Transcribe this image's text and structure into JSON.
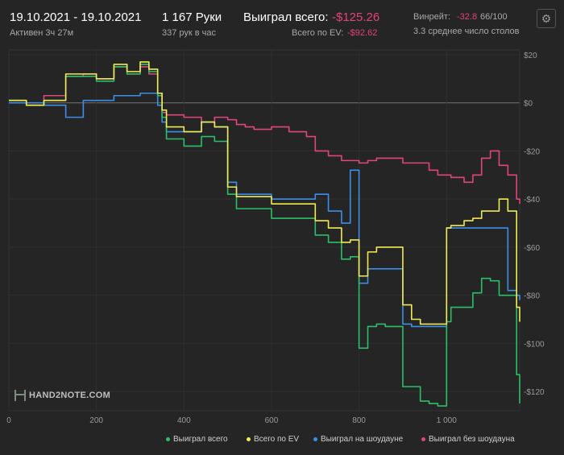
{
  "header": {
    "date_range": "19.10.2021 - 19.10.2021",
    "active_time": "Активен 3ч 27м",
    "hands": "1 167 Руки",
    "hands_per_hour": "337 рук в час",
    "won_total_label": "Выиграл всего:",
    "won_total_value": "-$125.26",
    "ev_label": "Всего по EV:",
    "ev_value": "-$92.62",
    "winrate_label": "Винрейт:",
    "winrate_value": "-32.8",
    "winrate_unit": "66/100",
    "avg_tables": "3.3 среднее число столов"
  },
  "logo": {
    "text": "HAND2NOTE.COM"
  },
  "icons": {
    "settings": "gear-icon"
  },
  "colors": {
    "background": "#252525",
    "negative": "#e0457b",
    "won_total": "#2bbf6a",
    "ev": "#f2ea52",
    "showdown": "#3b8fe8",
    "non_showdown": "#e0457b"
  },
  "chart_data": {
    "type": "line",
    "xlim": [
      0,
      1167
    ],
    "ylim": [
      -128,
      22
    ],
    "x_ticks": [
      0,
      200,
      400,
      600,
      800,
      1000
    ],
    "x_tick_labels": [
      "0",
      "200",
      "400",
      "600",
      "800",
      "1 000"
    ],
    "y_ticks": [
      20,
      0,
      -20,
      -40,
      -60,
      -80,
      -100,
      -120
    ],
    "y_tick_labels": [
      "$20",
      "$0",
      "-$20",
      "-$40",
      "-$60",
      "-$80",
      "-$100",
      "-$120"
    ],
    "grid": true,
    "legend_position": "bottom-right",
    "series": [
      {
        "name": "Выиграл всего",
        "color": "#2bbf6a",
        "x": [
          0,
          40,
          80,
          130,
          170,
          200,
          240,
          270,
          300,
          320,
          340,
          350,
          360,
          400,
          440,
          470,
          500,
          520,
          540,
          560,
          600,
          640,
          680,
          700,
          730,
          760,
          780,
          790,
          800,
          820,
          840,
          860,
          880,
          900,
          920,
          940,
          960,
          980,
          1000,
          1010,
          1040,
          1060,
          1080,
          1100,
          1120,
          1140,
          1160,
          1167
        ],
        "y": [
          1,
          -1,
          1,
          11,
          11,
          9,
          15,
          12,
          16,
          13,
          3,
          -6,
          -15,
          -18,
          -14,
          -16,
          -38,
          -44,
          -44,
          -44,
          -48,
          -48,
          -48,
          -55,
          -58,
          -65,
          -64,
          -64,
          -102,
          -93,
          -92,
          -93,
          -93,
          -118,
          -118,
          -124,
          -125,
          -126,
          -91,
          -85,
          -85,
          -79,
          -73,
          -74,
          -80,
          -80,
          -113,
          -125
        ]
      },
      {
        "name": "Всего по EV",
        "color": "#f2ea52",
        "x": [
          0,
          40,
          80,
          130,
          170,
          200,
          240,
          270,
          300,
          320,
          340,
          350,
          360,
          400,
          440,
          470,
          500,
          520,
          540,
          560,
          600,
          640,
          680,
          700,
          730,
          760,
          780,
          790,
          800,
          820,
          840,
          860,
          880,
          900,
          920,
          940,
          960,
          980,
          1000,
          1010,
          1040,
          1060,
          1080,
          1100,
          1120,
          1140,
          1160,
          1167
        ],
        "y": [
          1,
          -1,
          1,
          12,
          12,
          10,
          16,
          13,
          17,
          14,
          4,
          -3,
          -10,
          -12,
          -8,
          -10,
          -35,
          -39,
          -39,
          -39,
          -42,
          -42,
          -42,
          -49,
          -52,
          -58,
          -57,
          -57,
          -72,
          -62,
          -60,
          -60,
          -60,
          -84,
          -90,
          -92,
          -92,
          -92,
          -52,
          -51,
          -49,
          -48,
          -45,
          -45,
          -40,
          -45,
          -85,
          -91
        ]
      },
      {
        "name": "Выиграл на шоудауне",
        "color": "#3b8fe8",
        "x": [
          0,
          40,
          80,
          130,
          170,
          200,
          240,
          270,
          300,
          320,
          340,
          350,
          360,
          400,
          440,
          470,
          500,
          520,
          540,
          560,
          600,
          640,
          680,
          700,
          730,
          760,
          780,
          790,
          800,
          820,
          840,
          860,
          880,
          900,
          920,
          940,
          960,
          980,
          1000,
          1010,
          1040,
          1060,
          1080,
          1100,
          1120,
          1140,
          1160,
          1167
        ],
        "y": [
          0,
          0,
          -1,
          -6,
          1,
          1,
          3,
          3,
          4,
          4,
          -1,
          -8,
          -12,
          -12,
          -8,
          -10,
          -33,
          -38,
          -38,
          -38,
          -40,
          -40,
          -40,
          -38,
          -45,
          -50,
          -28,
          -28,
          -75,
          -69,
          -69,
          -69,
          -69,
          -92,
          -93,
          -93,
          -93,
          -93,
          -52,
          -52,
          -52,
          -52,
          -52,
          -52,
          -52,
          -78,
          -80,
          -82
        ]
      },
      {
        "name": "Выиграл без шоудауна",
        "color": "#e0457b",
        "x": [
          0,
          40,
          80,
          130,
          170,
          200,
          240,
          270,
          300,
          320,
          340,
          350,
          360,
          400,
          440,
          470,
          500,
          520,
          540,
          560,
          600,
          640,
          680,
          700,
          730,
          760,
          780,
          790,
          800,
          820,
          840,
          860,
          880,
          900,
          920,
          940,
          960,
          980,
          1000,
          1010,
          1040,
          1060,
          1080,
          1100,
          1120,
          1140,
          1160,
          1167
        ],
        "y": [
          1,
          -1,
          3,
          11,
          12,
          10,
          15,
          12,
          15,
          12,
          4,
          -4,
          -5,
          -6,
          -8,
          -6,
          -7,
          -9,
          -10,
          -11,
          -10,
          -12,
          -14,
          -20,
          -22,
          -24,
          -24,
          -24,
          -25,
          -24,
          -23,
          -23,
          -23,
          -25,
          -25,
          -25,
          -28,
          -30,
          -30,
          -31,
          -33,
          -30,
          -23,
          -20,
          -26,
          -30,
          -40,
          -42
        ]
      }
    ]
  }
}
